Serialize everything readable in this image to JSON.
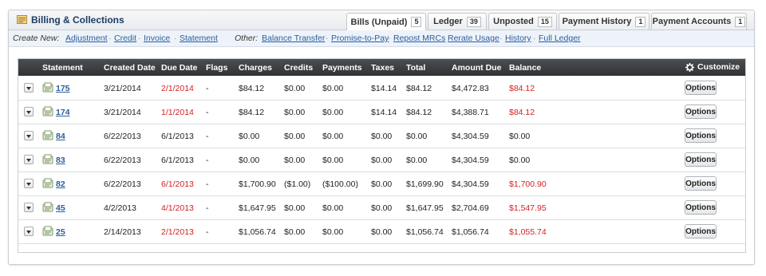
{
  "header": {
    "title": "Billing & Collections",
    "tabs": [
      {
        "label": "Bills (Unpaid)",
        "count": "5"
      },
      {
        "label": "Ledger",
        "count": "39"
      },
      {
        "label": "Unposted",
        "count": "15"
      },
      {
        "label": "Payment History",
        "count": "1"
      },
      {
        "label": "Payment Accounts",
        "count": "1"
      }
    ]
  },
  "subbar": {
    "create_label": "Create New:",
    "create_links": [
      "Adjustment",
      "Credit",
      "Invoice",
      "Statement"
    ],
    "other_label": "Other:",
    "other_links": [
      "Balance Transfer",
      "Promise-to-Pay",
      "Repost MRCs",
      "Rerate Usage",
      "History",
      "Full Ledger"
    ]
  },
  "table": {
    "columns": [
      "Statement",
      "Created Date",
      "Due Date",
      "Flags",
      "Charges",
      "Credits",
      "Payments",
      "Taxes",
      "Total",
      "Amount Due",
      "Balance"
    ],
    "customize_label": "Customize",
    "options_label": "Options",
    "rows": [
      {
        "statement": "175",
        "created": "3/21/2014",
        "due": "2/1/2014",
        "flags": "-",
        "charges": "$84.12",
        "credits": "$0.00",
        "payments": "$0.00",
        "taxes": "$14.14",
        "total": "$84.12",
        "amount_due": "$4,472.83",
        "balance": "$84.12"
      },
      {
        "statement": "174",
        "created": "3/21/2014",
        "due": "1/1/2014",
        "flags": "-",
        "charges": "$84.12",
        "credits": "$0.00",
        "payments": "$0.00",
        "taxes": "$14.14",
        "total": "$84.12",
        "amount_due": "$4,388.71",
        "balance": "$84.12"
      },
      {
        "statement": "84",
        "created": "6/22/2013",
        "due": "6/1/2013",
        "flags": "-",
        "charges": "$0.00",
        "credits": "$0.00",
        "payments": "$0.00",
        "taxes": "$0.00",
        "total": "$0.00",
        "amount_due": "$4,304.59",
        "balance": "$0.00"
      },
      {
        "statement": "83",
        "created": "6/22/2013",
        "due": "6/1/2013",
        "flags": "-",
        "charges": "$0.00",
        "credits": "$0.00",
        "payments": "$0.00",
        "taxes": "$0.00",
        "total": "$0.00",
        "amount_due": "$4,304.59",
        "balance": "$0.00"
      },
      {
        "statement": "82",
        "created": "6/22/2013",
        "due": "6/1/2013",
        "flags": "-",
        "charges": "$1,700.90",
        "credits": "($1.00)",
        "payments": "($100.00)",
        "taxes": "$0.00",
        "total": "$1,699.90",
        "amount_due": "$4,304.59",
        "balance": "$1,700.90"
      },
      {
        "statement": "45",
        "created": "4/2/2013",
        "due": "4/1/2013",
        "flags": "-",
        "charges": "$1,647.95",
        "credits": "$0.00",
        "payments": "$0.00",
        "taxes": "$0.00",
        "total": "$1,647.95",
        "amount_due": "$2,704.69",
        "balance": "$1,547.95"
      },
      {
        "statement": "25",
        "created": "2/14/2013",
        "due": "2/1/2013",
        "flags": "-",
        "charges": "$1,056.74",
        "credits": "$0.00",
        "payments": "$0.00",
        "taxes": "$0.00",
        "total": "$1,056.74",
        "amount_due": "$1,056.74",
        "balance": "$1,055.74"
      }
    ]
  },
  "colors": {
    "overdue": "#d42020",
    "link": "#2a5d9f",
    "header_bg": "#3a3d40"
  }
}
